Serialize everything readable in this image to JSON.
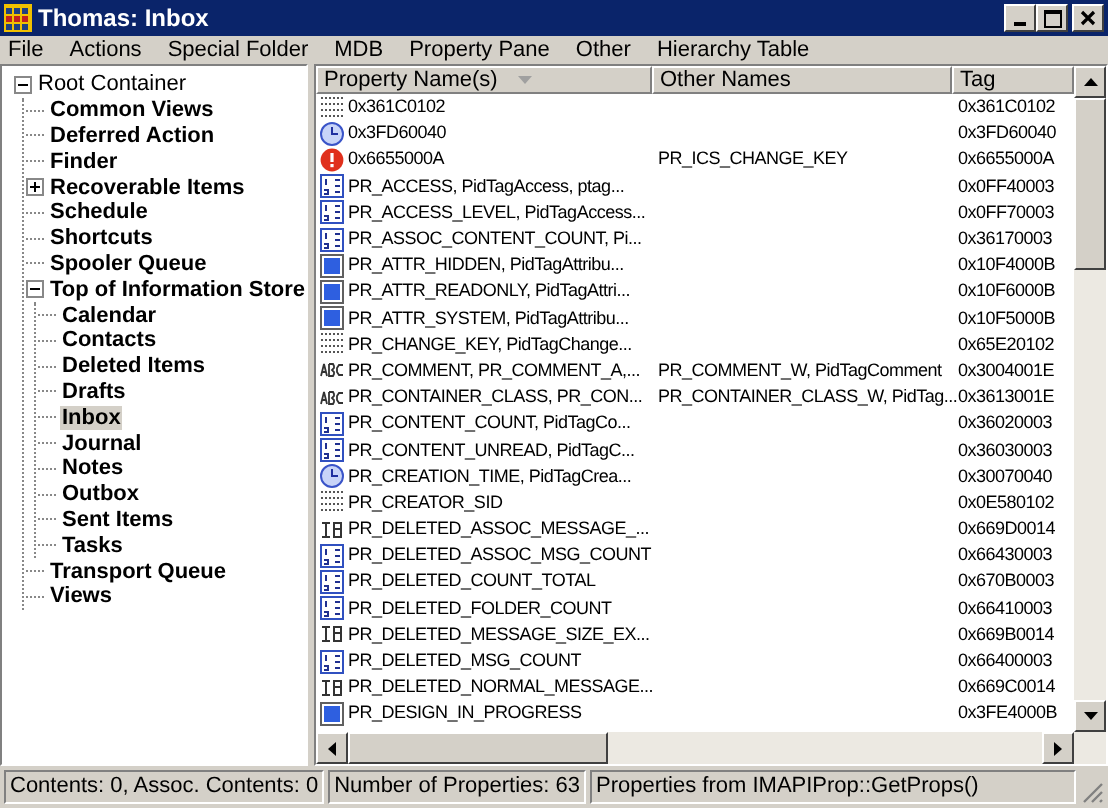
{
  "window": {
    "title": "Thomas: Inbox"
  },
  "menu": [
    "File",
    "Actions",
    "Special Folder",
    "MDB",
    "Property Pane",
    "Other",
    "Hierarchy Table"
  ],
  "tree": [
    {
      "label": "Root Container",
      "expanded": true,
      "selected": false,
      "children": [
        {
          "label": "Common Views",
          "selected": false
        },
        {
          "label": "Deferred Action",
          "selected": false
        },
        {
          "label": "Finder",
          "selected": false
        },
        {
          "label": "Recoverable Items",
          "expanded": false,
          "selected": false
        },
        {
          "label": "Schedule",
          "selected": false
        },
        {
          "label": "Shortcuts",
          "selected": false
        },
        {
          "label": "Spooler Queue",
          "selected": false
        },
        {
          "label": "Top of Information Store",
          "expanded": true,
          "selected": false,
          "children": [
            {
              "label": "Calendar",
              "selected": false
            },
            {
              "label": "Contacts",
              "selected": false
            },
            {
              "label": "Deleted Items",
              "selected": false
            },
            {
              "label": "Drafts",
              "selected": false
            },
            {
              "label": "Inbox",
              "selected": true
            },
            {
              "label": "Journal",
              "selected": false
            },
            {
              "label": "Notes",
              "selected": false
            },
            {
              "label": "Outbox",
              "selected": false
            },
            {
              "label": "Sent Items",
              "selected": false
            },
            {
              "label": "Tasks",
              "selected": false
            }
          ]
        },
        {
          "label": "Transport Queue",
          "selected": false
        },
        {
          "label": "Views",
          "selected": false
        }
      ]
    }
  ],
  "table": {
    "columns": [
      "Property Name(s)",
      "Other Names",
      "Tag"
    ],
    "rows": [
      {
        "kind": "binary",
        "name": "0x361C0102",
        "other": "",
        "tag": "0x361C0102"
      },
      {
        "kind": "time",
        "name": "0x3FD60040",
        "other": "",
        "tag": "0x3FD60040"
      },
      {
        "kind": "error",
        "name": "0x6655000A",
        "other": "PR_ICS_CHANGE_KEY",
        "tag": "0x6655000A"
      },
      {
        "kind": "long",
        "name": "PR_ACCESS, PidTagAccess, ptag...",
        "other": "",
        "tag": "0x0FF40003"
      },
      {
        "kind": "long",
        "name": "PR_ACCESS_LEVEL, PidTagAccess...",
        "other": "",
        "tag": "0x0FF70003"
      },
      {
        "kind": "long",
        "name": "PR_ASSOC_CONTENT_COUNT, Pi...",
        "other": "",
        "tag": "0x36170003"
      },
      {
        "kind": "bool",
        "name": "PR_ATTR_HIDDEN, PidTagAttribu...",
        "other": "",
        "tag": "0x10F4000B"
      },
      {
        "kind": "bool",
        "name": "PR_ATTR_READONLY, PidTagAttri...",
        "other": "",
        "tag": "0x10F6000B"
      },
      {
        "kind": "bool",
        "name": "PR_ATTR_SYSTEM, PidTagAttribu...",
        "other": "",
        "tag": "0x10F5000B"
      },
      {
        "kind": "binary",
        "name": "PR_CHANGE_KEY, PidTagChange...",
        "other": "",
        "tag": "0x65E20102"
      },
      {
        "kind": "string",
        "name": "PR_COMMENT, PR_COMMENT_A,...",
        "other": "PR_COMMENT_W, PidTagComment",
        "tag": "0x3004001E"
      },
      {
        "kind": "string",
        "name": "PR_CONTAINER_CLASS, PR_CON...",
        "other": "PR_CONTAINER_CLASS_W, PidTag...",
        "tag": "0x3613001E"
      },
      {
        "kind": "long",
        "name": "PR_CONTENT_COUNT, PidTagCo...",
        "other": "",
        "tag": "0x36020003"
      },
      {
        "kind": "long",
        "name": "PR_CONTENT_UNREAD, PidTagC...",
        "other": "",
        "tag": "0x36030003"
      },
      {
        "kind": "time",
        "name": "PR_CREATION_TIME, PidTagCrea...",
        "other": "",
        "tag": "0x30070040"
      },
      {
        "kind": "binary",
        "name": "PR_CREATOR_SID",
        "other": "",
        "tag": "0x0E580102"
      },
      {
        "kind": "i8",
        "name": "PR_DELETED_ASSOC_MESSAGE_...",
        "other": "",
        "tag": "0x669D0014"
      },
      {
        "kind": "long",
        "name": "PR_DELETED_ASSOC_MSG_COUNT",
        "other": "",
        "tag": "0x66430003"
      },
      {
        "kind": "long",
        "name": "PR_DELETED_COUNT_TOTAL",
        "other": "",
        "tag": "0x670B0003"
      },
      {
        "kind": "long",
        "name": "PR_DELETED_FOLDER_COUNT",
        "other": "",
        "tag": "0x66410003"
      },
      {
        "kind": "i8",
        "name": "PR_DELETED_MESSAGE_SIZE_EX...",
        "other": "",
        "tag": "0x669B0014"
      },
      {
        "kind": "long",
        "name": "PR_DELETED_MSG_COUNT",
        "other": "",
        "tag": "0x66400003"
      },
      {
        "kind": "i8",
        "name": "PR_DELETED_NORMAL_MESSAGE...",
        "other": "",
        "tag": "0x669C0014"
      },
      {
        "kind": "bool",
        "name": "PR_DESIGN_IN_PROGRESS",
        "other": "",
        "tag": "0x3FE4000B"
      }
    ]
  },
  "status_bar": [
    "Contents: 0, Assoc. Contents: 0",
    "Number of Properties: 63",
    "Properties from IMAPIProp::GetProps()"
  ]
}
